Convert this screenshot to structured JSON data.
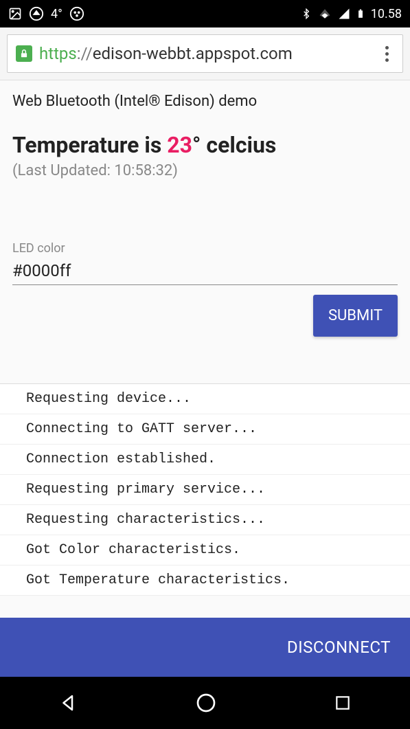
{
  "statusBar": {
    "temperature": "4°",
    "time": "10.58"
  },
  "urlBar": {
    "scheme": "https",
    "sep": "://",
    "host": "edison-webbt.appspot.com"
  },
  "page": {
    "demoTitle": "Web Bluetooth (Intel® Edison) demo",
    "tempPrefix": "Temperature is ",
    "tempValue": "23",
    "tempSuffix": "° celcius",
    "lastUpdatedPrefix": "(Last Updated: ",
    "lastUpdatedTime": "10:58:32",
    "lastUpdatedSuffix": ")",
    "ledLabel": "LED color",
    "ledValue": "#0000ff",
    "submitLabel": "SUBMIT"
  },
  "log": [
    "Requesting device...",
    "Connecting to GATT server...",
    "Connection established.",
    "Requesting primary service...",
    "Requesting characteristics...",
    "Got Color characteristics.",
    "Got Temperature characteristics."
  ],
  "footer": {
    "disconnectLabel": "DISCONNECT"
  }
}
